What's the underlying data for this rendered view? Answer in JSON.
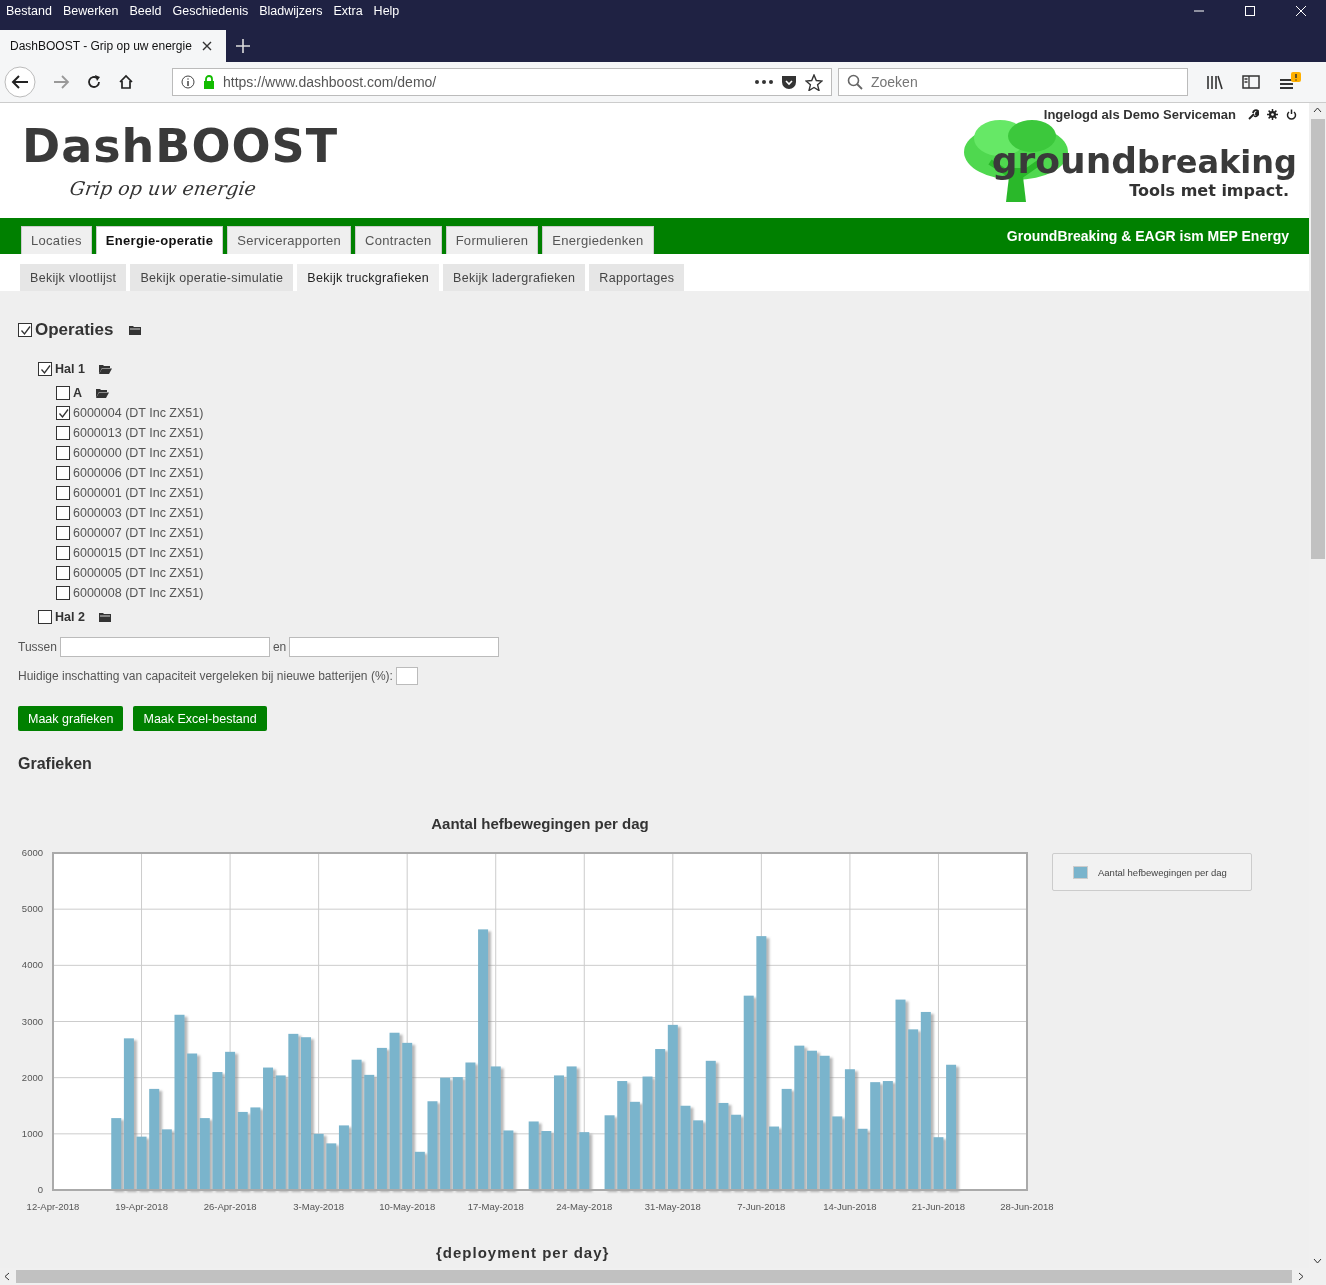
{
  "browser": {
    "menu": [
      "Bestand",
      "Bewerken",
      "Beeld",
      "Geschiedenis",
      "Bladwijzers",
      "Extra",
      "Help"
    ],
    "tab_title": "DashBOOST - Grip op uw energie",
    "url": "https://www.dashboost.com/demo/",
    "search": {
      "placeholder": "Zoeken"
    }
  },
  "header": {
    "login_text": "Ingelogd als Demo Serviceman",
    "brand": "DashBOOST",
    "tagline": "Grip op uw energie",
    "partner_logo": {
      "word1": "ground",
      "word2": "breaking",
      "tagline": "Tools met impact."
    }
  },
  "main_tabs": [
    {
      "label": "Locaties",
      "selected": false
    },
    {
      "label": "Energie-operatie",
      "selected": true
    },
    {
      "label": "Servicerapporten",
      "selected": false
    },
    {
      "label": "Contracten",
      "selected": false
    },
    {
      "label": "Formulieren",
      "selected": false
    },
    {
      "label": "Energiedenken",
      "selected": false
    }
  ],
  "partner_text": "GroundBreaking & EAGR ism MEP Energy",
  "sub_tabs": [
    {
      "label": "Bekijk vlootlijst",
      "selected": false
    },
    {
      "label": "Bekijk operatie-simulatie",
      "selected": false
    },
    {
      "label": "Bekijk truckgrafieken",
      "selected": true
    },
    {
      "label": "Bekijk ladergrafieken",
      "selected": false
    },
    {
      "label": "Rapportages",
      "selected": false
    }
  ],
  "tree": {
    "kind": "root",
    "label": "Operaties",
    "checked": true,
    "folder_open": false,
    "children": [
      {
        "kind": "group",
        "label": "Hal 1",
        "checked": true,
        "folder_open": true,
        "children": [
          {
            "kind": "group",
            "label": "A",
            "checked": false,
            "folder_open": true
          },
          {
            "kind": "item",
            "label": "6000004 (DT Inc ZX51)",
            "checked": true
          },
          {
            "kind": "item",
            "label": "6000013 (DT Inc ZX51)",
            "checked": false
          },
          {
            "kind": "item",
            "label": "6000000 (DT Inc ZX51)",
            "checked": false
          },
          {
            "kind": "item",
            "label": "6000006 (DT Inc ZX51)",
            "checked": false
          },
          {
            "kind": "item",
            "label": "6000001 (DT Inc ZX51)",
            "checked": false
          },
          {
            "kind": "item",
            "label": "6000003 (DT Inc ZX51)",
            "checked": false
          },
          {
            "kind": "item",
            "label": "6000007 (DT Inc ZX51)",
            "checked": false
          },
          {
            "kind": "item",
            "label": "6000015 (DT Inc ZX51)",
            "checked": false
          },
          {
            "kind": "item",
            "label": "6000005 (DT Inc ZX51)",
            "checked": false
          },
          {
            "kind": "item",
            "label": "6000008 (DT Inc ZX51)",
            "checked": false
          }
        ]
      },
      {
        "kind": "group",
        "label": "Hal 2",
        "checked": false,
        "folder_open": false
      }
    ]
  },
  "period": {
    "label_from": "Tussen",
    "label_to": "en"
  },
  "capacity": {
    "label": "Huidige inschatting van capaciteit vergeleken bij nieuwe batterijen (%):"
  },
  "buttons": [
    "Maak grafieken",
    "Maak Excel-bestand"
  ],
  "charts_heading": "Grafieken",
  "chart": {
    "chart_data": {
      "type": "bar",
      "title": "Aantal hefbewegingen per dag",
      "categories": [
        "12-Apr-2018",
        null,
        null,
        null,
        null,
        null,
        null,
        "19-Apr-2018",
        null,
        null,
        null,
        null,
        null,
        null,
        "26-Apr-2018",
        null,
        null,
        null,
        null,
        null,
        null,
        "3-May-2018",
        null,
        null,
        null,
        null,
        null,
        null,
        "10-May-2018",
        null,
        null,
        null,
        null,
        null,
        null,
        "17-May-2018",
        null,
        null,
        null,
        null,
        null,
        null,
        "24-May-2018",
        null,
        null,
        null,
        null,
        null,
        null,
        "31-May-2018",
        null,
        null,
        null,
        null,
        null,
        null,
        "7-Jun-2018",
        null,
        null,
        null,
        null,
        null,
        null,
        "14-Jun-2018",
        null,
        null,
        null,
        null,
        null,
        null,
        "21-Jun-2018",
        null,
        null,
        null,
        null,
        null,
        null,
        "28-Jun-2018"
      ],
      "series": [
        {
          "name": "Aantal hefbewegingen per dag",
          "color": "#7ab4cc",
          "values": [
            null,
            null,
            null,
            null,
            null,
            1280,
            2700,
            950,
            1800,
            1080,
            3120,
            2430,
            1280,
            2100,
            2460,
            1390,
            1470,
            2180,
            2040,
            2780,
            2720,
            1000,
            830,
            1150,
            2320,
            2050,
            2530,
            2800,
            2620,
            680,
            1580,
            2000,
            2010,
            2270,
            4640,
            2200,
            1060,
            null,
            1220,
            1050,
            2040,
            2200,
            1030,
            null,
            1330,
            1940,
            1570,
            2020,
            2510,
            2940,
            1500,
            1240,
            2300,
            1550,
            1340,
            3460,
            4520,
            1130,
            1800,
            2570,
            2480,
            2390,
            1310,
            2150,
            1090,
            1920,
            1940,
            3390,
            2860,
            3170,
            940,
            2230,
            null,
            null,
            null,
            null,
            null,
            null
          ]
        }
      ],
      "ylim": [
        0,
        6000
      ],
      "grid": true,
      "yticks": [
        0,
        1000,
        2000,
        3000,
        4000,
        5000,
        6000
      ]
    }
  },
  "next_chart_title": "{deployment per day}"
}
